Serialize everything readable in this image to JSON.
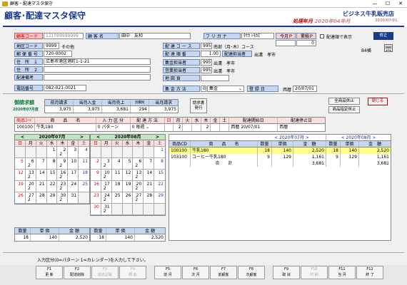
{
  "window": {
    "title": "顧客・配達マスタ保守",
    "min": "—",
    "max": "☐",
    "close": "✕"
  },
  "header": {
    "title": "顧客･配達マスタ保守",
    "company": "ビジネス牛乳販売店",
    "period_label": "処理年月",
    "period_value": "2020年04年月",
    "period_date": "2020/07/01"
  },
  "customer": {
    "code_label": "顧客コード",
    "code": "121099999999",
    "name_label": "顧 客 名",
    "name": "田中　友和",
    "kana_label": "フ リ ガ ナ",
    "kana": "ﾀﾅｶ ﾄﾓｶｽﾞ",
    "district_label": "地区コード",
    "district": "9999",
    "district_name": "その他",
    "zip_label": "郵 便 番 号",
    "zip": "720-0002",
    "addr1_label": "住　所　１",
    "addr1": "広島市港区港町1-1-21",
    "addr2_label": "住　所　２",
    "addr2": "",
    "delivery_note_label": "配達備考",
    "delivery_note": "",
    "phone_label": "電話番号",
    "phone": "082-021-0021"
  },
  "delivery": {
    "course_label": "配 達 コ ー ス",
    "course": "995",
    "course_name": "南部（月･木）コース",
    "order_label": "配 達 順 番",
    "order": "1.00",
    "person_label": "配達担当者",
    "person": "出溝　孝市",
    "collector_label": "集金担当者",
    "collector_code": "995",
    "collector": "出溝　孝市",
    "sales_label": "営業担当者",
    "sales_code": "995",
    "sales": "出溝　孝市",
    "map_label": "地 図 頁",
    "map": "",
    "method_label": "集 金 方 法",
    "method_code": "0",
    "method": "集金",
    "reg_label": "登 録 日",
    "reg_era": "西暦",
    "reg_date": "20/07/01"
  },
  "right_panel": {
    "month_p_label": "今月Ｐ",
    "points_label": "累積Ｐ",
    "month_p": "",
    "points": "0",
    "order_chk_label": "配達順で表示",
    "fix_button": "修正",
    "b4_label": "B4横"
  },
  "billing": {
    "title": "御請求額",
    "title_month": "2020年07月度",
    "cols": [
      "前月請求",
      "当月入金",
      "当月売上",
      "消費税",
      "当月請求"
    ],
    "vals": [
      "3,975",
      "3,975",
      "3,681",
      "294",
      "3,975"
    ],
    "btn_invoice": "請求書\n発行",
    "btn_stop_all": "全商品休止",
    "btn_stop_spec": "商品指定休止",
    "btn_close": "閉じる"
  },
  "product_hdr": {
    "cols": [
      "商品ｺｰﾄﾞ",
      "商　　品　　名",
      "入 力 区 分",
      "配 達 方 法",
      "日",
      "月",
      "火",
      "水",
      "木",
      "金",
      "土",
      "配達開始日",
      "配達停止日"
    ],
    "code": "100100",
    "name": "牛乳180",
    "input_type": "0 パターン",
    "method_code": "0",
    "method": "毎週",
    "qty": [
      "",
      "2",
      "",
      "",
      "2",
      "",
      ""
    ],
    "start_era": "西暦",
    "start": "20/07/01",
    "stop_era": "西暦",
    "stop": ""
  },
  "calendar1": {
    "title": "2020年07月",
    "dow": [
      "日",
      "月",
      "火",
      "水",
      "木",
      "金",
      "土"
    ],
    "cells": [
      [
        "",
        ""
      ],
      [
        "",
        ""
      ],
      [
        "",
        ""
      ],
      [
        "1",
        ""
      ],
      [
        "2",
        "2"
      ],
      [
        "3",
        ""
      ],
      [
        "4",
        ""
      ],
      [
        "5",
        ""
      ],
      [
        "6",
        "2"
      ],
      [
        "7",
        ""
      ],
      [
        "8",
        ""
      ],
      [
        "9",
        "2"
      ],
      [
        "10",
        ""
      ],
      [
        "11",
        ""
      ],
      [
        "12",
        ""
      ],
      [
        "13",
        "2"
      ],
      [
        "14",
        ""
      ],
      [
        "15",
        ""
      ],
      [
        "16",
        "2"
      ],
      [
        "17",
        ""
      ],
      [
        "18",
        ""
      ],
      [
        "19",
        ""
      ],
      [
        "20",
        "2"
      ],
      [
        "21",
        ""
      ],
      [
        "22",
        ""
      ],
      [
        "23",
        "2"
      ],
      [
        "24",
        ""
      ],
      [
        "25",
        ""
      ],
      [
        "26",
        ""
      ],
      [
        "27",
        "2"
      ],
      [
        "28",
        ""
      ],
      [
        "29",
        ""
      ],
      [
        "30",
        "2"
      ],
      [
        "31",
        ""
      ],
      [
        "",
        ""
      ]
    ],
    "sum_cols": [
      "数量",
      "単 価",
      "金 額"
    ],
    "sum_vals": [
      "18",
      "140",
      "2,520"
    ]
  },
  "calendar2": {
    "title": "2020年08月",
    "dow": [
      "日",
      "月",
      "火",
      "水",
      "木",
      "金",
      "土"
    ],
    "cells": [
      [
        "",
        ""
      ],
      [
        "",
        ""
      ],
      [
        "",
        ""
      ],
      [
        "",
        ""
      ],
      [
        "",
        ""
      ],
      [
        "",
        ""
      ],
      [
        "1",
        ""
      ],
      [
        "2",
        ""
      ],
      [
        "3",
        "2"
      ],
      [
        "4",
        ""
      ],
      [
        "5",
        ""
      ],
      [
        "6",
        "2"
      ],
      [
        "7",
        ""
      ],
      [
        "8",
        ""
      ],
      [
        "9",
        ""
      ],
      [
        "10",
        "2"
      ],
      [
        "11",
        ""
      ],
      [
        "12",
        ""
      ],
      [
        "13",
        "2"
      ],
      [
        "14",
        ""
      ],
      [
        "15",
        ""
      ],
      [
        "16",
        ""
      ],
      [
        "17",
        "2"
      ],
      [
        "18",
        ""
      ],
      [
        "19",
        ""
      ],
      [
        "20",
        "2"
      ],
      [
        "21",
        ""
      ],
      [
        "22",
        ""
      ],
      [
        "23",
        ""
      ],
      [
        "24",
        "2"
      ],
      [
        "25",
        ""
      ],
      [
        "26",
        ""
      ],
      [
        "27",
        "2"
      ],
      [
        "28",
        ""
      ],
      [
        "29",
        ""
      ],
      [
        "30",
        ""
      ],
      [
        "31",
        "2"
      ],
      [
        "",
        ""
      ],
      [
        "",
        ""
      ],
      [
        "",
        ""
      ],
      [
        "",
        ""
      ],
      [
        "",
        ""
      ]
    ],
    "sum_cols": [
      "数量",
      "単 価",
      "金 額"
    ],
    "sum_vals": [
      "18",
      "140",
      "2,520"
    ]
  },
  "summary": {
    "month1": "2020年07月",
    "month2": "2020年08月",
    "cols": [
      "商品CD",
      "商　　品　　名",
      "数量",
      "単価",
      "金　額",
      "数量",
      "単価",
      "金　額"
    ],
    "rows": [
      [
        "100100",
        "牛乳180",
        "18",
        "140",
        "2,520",
        "18",
        "140",
        "2,520"
      ],
      [
        "103100",
        "コーヒー牛乳180",
        "9",
        "129",
        "1,161",
        "9",
        "129",
        "1,161"
      ],
      [
        "",
        "合　　計",
        "",
        "",
        "3,681",
        "",
        "",
        "3,681"
      ]
    ]
  },
  "status": "入力区分(0=パターン 1=カレンダー)を入力して下さい。",
  "fkeys": [
    {
      "k": "F1",
      "l": "更 新",
      "d": false
    },
    {
      "k": "F2",
      "l": "配達削除",
      "d": false
    },
    {
      "k": "F3",
      "l": "過去記録",
      "d": true
    },
    {
      "k": "F4",
      "l": "照 会",
      "d": true
    },
    {
      "k": "F5",
      "l": "前 月",
      "d": false
    },
    {
      "k": "F6",
      "l": "次 月",
      "d": false
    },
    {
      "k": "F7",
      "l": "前顧客",
      "d": false
    },
    {
      "k": "F8",
      "l": "次顧客",
      "d": false
    },
    {
      "k": "F9",
      "l": "取 消",
      "d": false
    },
    {
      "k": "F10",
      "l": "印 刷",
      "d": true
    },
    {
      "k": "F11",
      "l": "当 月",
      "d": false
    },
    {
      "k": "F12",
      "l": "終 了",
      "d": false
    }
  ]
}
